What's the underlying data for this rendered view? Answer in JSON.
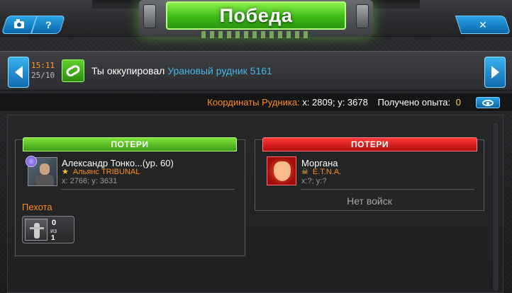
{
  "header": {
    "title": "Победа",
    "help_label": "?",
    "close_label": "✕"
  },
  "event": {
    "time": "15:11",
    "date": "25/10",
    "text_prefix": "Ты оккупировал",
    "target_link": "Урановый рудник 5161",
    "icon": "chain-link-icon"
  },
  "mine_info": {
    "coords_label": "Координаты Рудника:",
    "coords_value": "x: 2809; y: 3678",
    "xp_label": "Получено опыта:",
    "xp_value": "0"
  },
  "attacker": {
    "losses_label": "ПОТЕРИ",
    "name": "Александр Тонко...(ур. 60)",
    "alliance": "Альянс TRIBUNAL",
    "coords": "x: 2766; y: 3631",
    "section_title": "Пехота",
    "units": [
      {
        "count": "0",
        "of_label": "из",
        "total": "1"
      }
    ]
  },
  "defender": {
    "losses_label": "ПОТЕРИ",
    "name": "Моргана",
    "alliance": "E.T.N.A.",
    "coords": "x:?; y:?",
    "no_troops": "Нет войск"
  },
  "colors": {
    "accent_green": "#3dbb19",
    "accent_red": "#c01010",
    "link_blue": "#46b8ea",
    "orange": "#ff8a1f",
    "xp_yellow": "#ffd34a"
  }
}
